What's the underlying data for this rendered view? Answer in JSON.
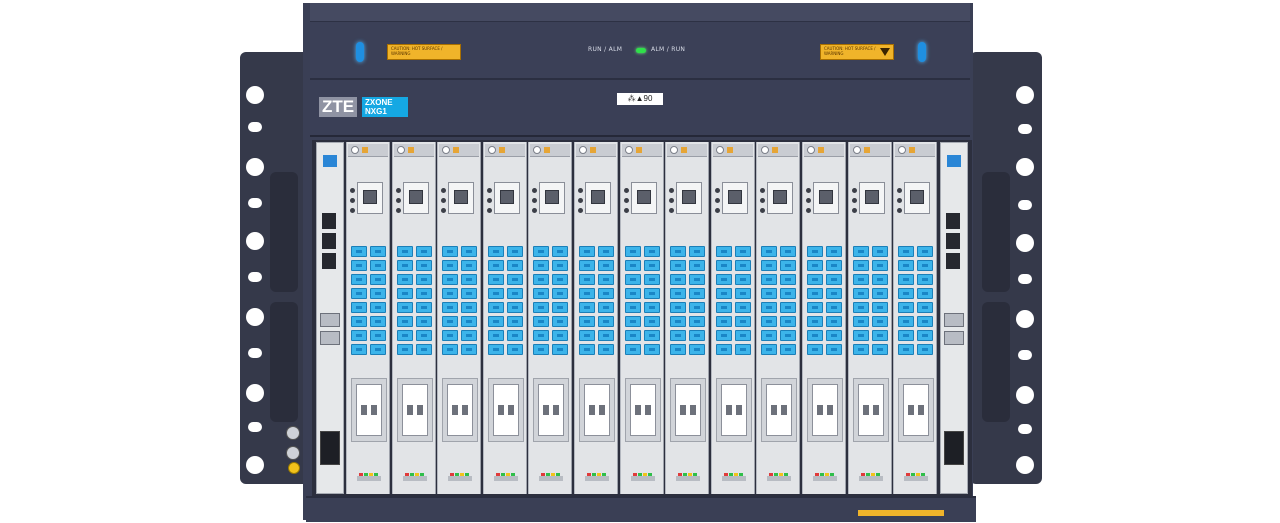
{
  "device": {
    "brand": "ZTE",
    "model_line1": "ZXONE",
    "model_line2": "NXG1",
    "id_plate": "⁂▲90"
  },
  "fan_tray": {
    "left_label": "RUN / ALM",
    "right_label": "ALM / RUN",
    "warning_text": "CAUTION: HOT SURFACE / WARNING",
    "led_color": "#2fe04a"
  },
  "colors": {
    "chassis": "#3a3f55",
    "port_blue": "#3cb4ea",
    "card_silver": "#e2e4e7"
  },
  "cards": {
    "count": 13
  }
}
